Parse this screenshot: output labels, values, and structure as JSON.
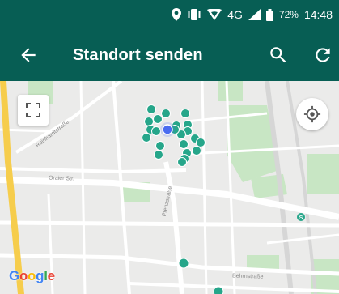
{
  "status_bar": {
    "network": "4G",
    "battery": "72%",
    "time": "14:48",
    "icons": [
      "location-icon",
      "vibrate-icon",
      "hotspot-icon",
      "signal-icon",
      "battery-icon"
    ]
  },
  "toolbar": {
    "title": "Standort senden",
    "icons": [
      "back-arrow-icon",
      "search-icon",
      "refresh-icon"
    ]
  },
  "map": {
    "provider": "Google",
    "streets": {
      "reinhardtstrasse": "Reinhardtstraße",
      "oranienstrasse": "Oraier Str.",
      "prenzstrasse": "Prenzstraße",
      "behrenstrasse": "Behrnstraße"
    },
    "controls": [
      "fullscreen-icon",
      "my-location-icon"
    ],
    "colors": {
      "marker": "#26a68a",
      "current_location": "#4a6cf0",
      "toolbar": "#075e54",
      "park": "#c8e6c4",
      "highway": "#f6cd4c"
    },
    "marker_count": 24
  }
}
